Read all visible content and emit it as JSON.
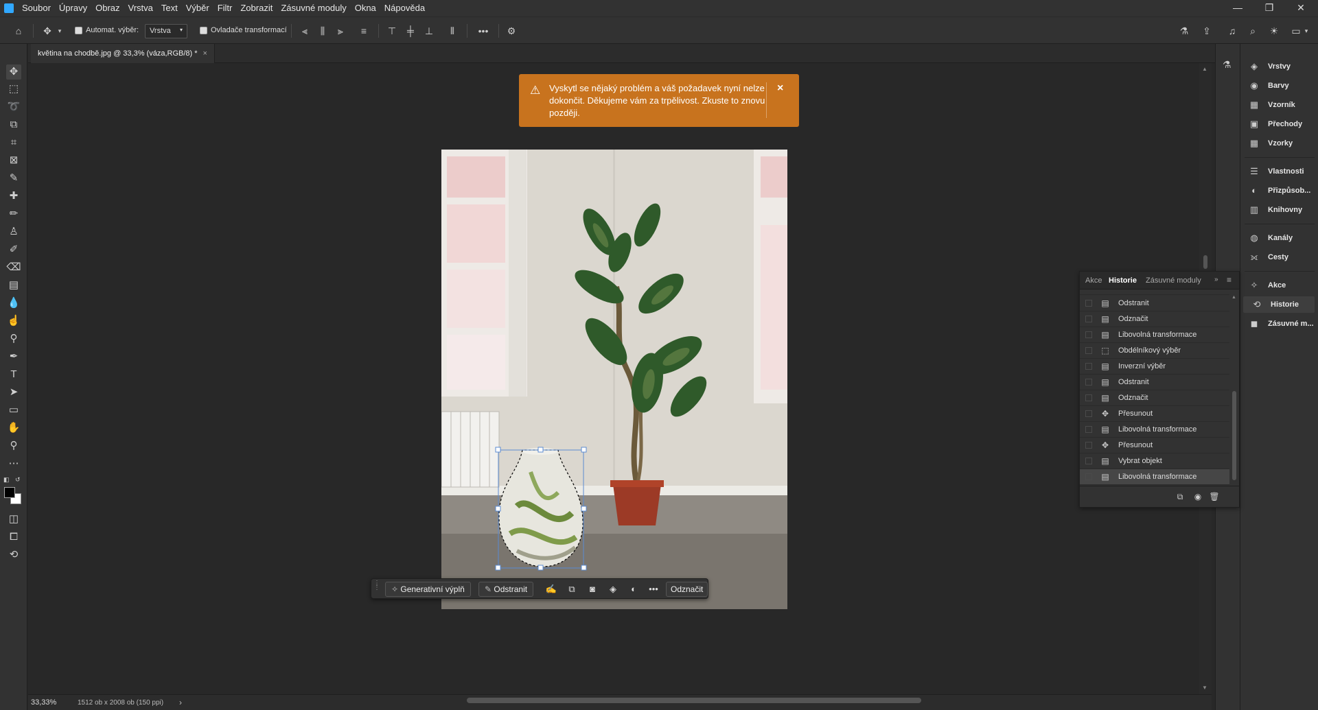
{
  "menubar": {
    "items": [
      "Soubor",
      "Úpravy",
      "Obraz",
      "Vrstva",
      "Text",
      "Výběr",
      "Filtr",
      "Zobrazit",
      "Zásuvné moduly",
      "Okna",
      "Nápověda"
    ],
    "controls": [
      "—",
      "❐",
      "✕"
    ]
  },
  "optbar": {
    "auto_select_label": "Automat. výběr:",
    "auto_select_value": "Vrstva",
    "transform_controls_label": "Ovladače transformací",
    "more": "•••"
  },
  "document": {
    "tab_title": "květina na chodbě.jpg @ 33,3% (váza,RGB/8) *",
    "tab_close": "×"
  },
  "notice": {
    "message": "Vyskytl se nějaký problém a váš požadavek nyní nelze dokončit. Děkujeme vám za trpělivost. Zkuste to znovu později.",
    "close": "×",
    "accent": "#c8731e"
  },
  "taskbar": {
    "generative_fill": "Generativní výplň",
    "remove": "Odstranit",
    "more": "•••",
    "deselect": "Odznačit"
  },
  "status": {
    "zoom": "33,33%",
    "doc_info": "1512 ob x 2008 ob (150 ppi)",
    "arrow": "›"
  },
  "history": {
    "tabs": [
      "Akce",
      "Historie",
      "Zásuvné moduly"
    ],
    "active_tab": "Historie",
    "items": [
      {
        "label": "Odstranit",
        "icon": "document-icon"
      },
      {
        "label": "Odznačit",
        "icon": "document-icon"
      },
      {
        "label": "Libovolná transformace",
        "icon": "document-icon"
      },
      {
        "label": "Obdélníkový výběr",
        "icon": "marquee-icon"
      },
      {
        "label": "Inverzní výběr",
        "icon": "document-icon"
      },
      {
        "label": "Odstranit",
        "icon": "document-icon"
      },
      {
        "label": "Odznačit",
        "icon": "document-icon"
      },
      {
        "label": "Přesunout",
        "icon": "move-icon"
      },
      {
        "label": "Libovolná transformace",
        "icon": "document-icon"
      },
      {
        "label": "Přesunout",
        "icon": "move-icon"
      },
      {
        "label": "Vybrat objekt",
        "icon": "document-icon"
      },
      {
        "label": "Libovolná transformace",
        "icon": "document-icon"
      }
    ]
  },
  "dock": {
    "group1": [
      "Vrstvy",
      "Barvy",
      "Vzorník",
      "Přechody",
      "Vzorky"
    ],
    "group2": [
      "Vlastnosti",
      "Přizpůsob...",
      "Knihovny"
    ],
    "group3": [
      "Kanály",
      "Cesty"
    ],
    "group4": [
      "Akce",
      "Historie",
      "Zásuvné m..."
    ],
    "active": "Historie"
  }
}
